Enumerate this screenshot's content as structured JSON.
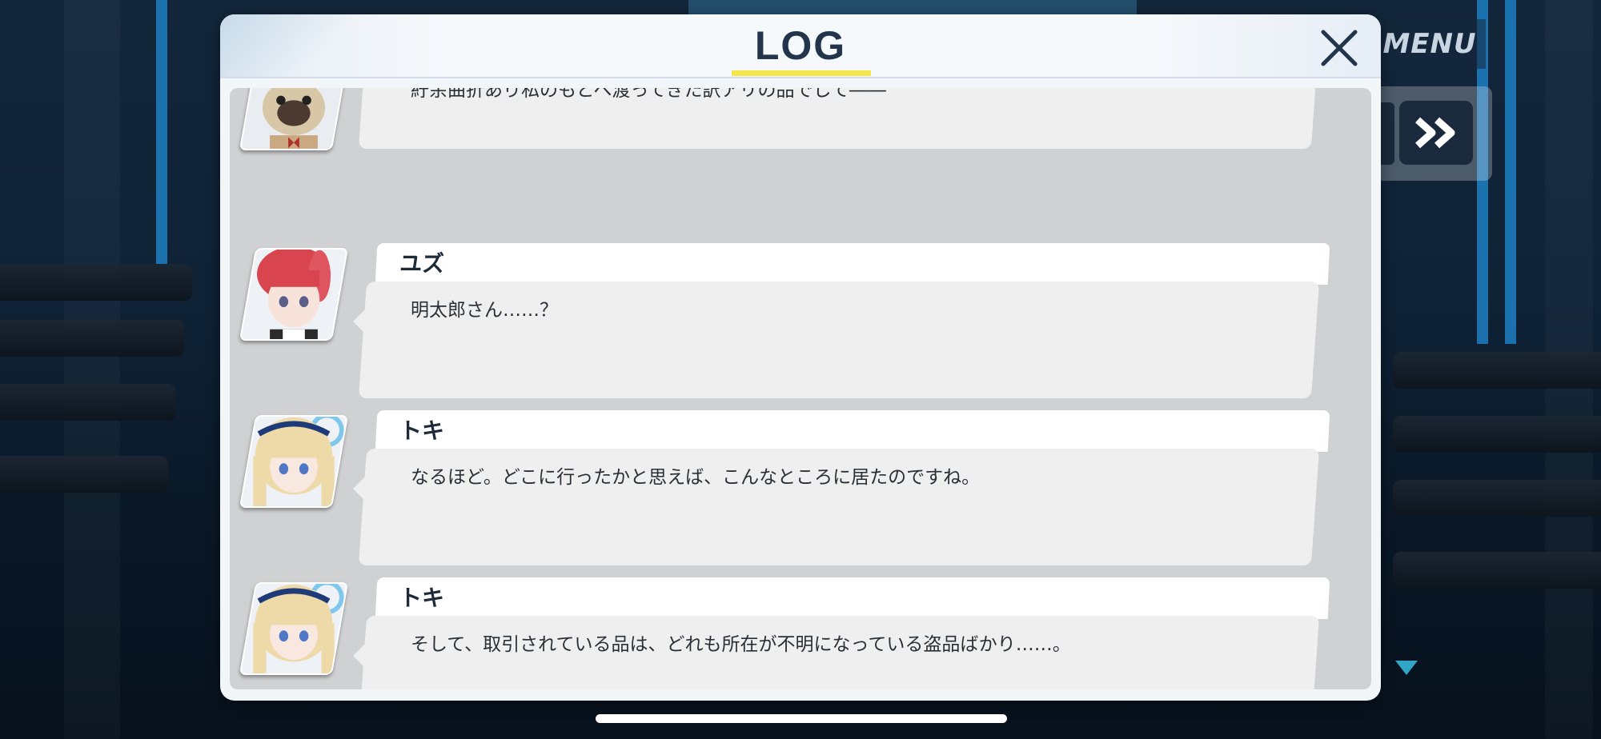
{
  "header": {
    "title": "LOG",
    "close_icon": "close-icon"
  },
  "controls": {
    "menu_label": "MENU",
    "skip_icon": "fast-forward-icon",
    "scroll_indicator_icon": "triangle-down-icon"
  },
  "log": {
    "entries": [
      {
        "speaker": "",
        "avatar": "pug-character-avatar",
        "message": "ブラックマーケットで抗争の火種となってから、\n紆余曲折あり私のもとへ渡ってきた訳アリの品でして――"
      },
      {
        "speaker": "ユズ",
        "avatar": "yuzu-avatar",
        "message": "明太郎さん……？"
      },
      {
        "speaker": "トキ",
        "avatar": "toki-avatar",
        "message": "なるほど。どこに行ったかと思えば、こんなところに居たのですね。"
      },
      {
        "speaker": "トキ",
        "avatar": "toki-avatar",
        "message": "そして、取引されている品は、どれも所在が不明になっている盗品ばかり……。"
      }
    ]
  },
  "colors": {
    "title_underline": "#f3e64a",
    "panel_bg": "#f3f6f9",
    "log_bg": "#cfd1d3",
    "scroll_indicator": "#2fa6c8"
  }
}
